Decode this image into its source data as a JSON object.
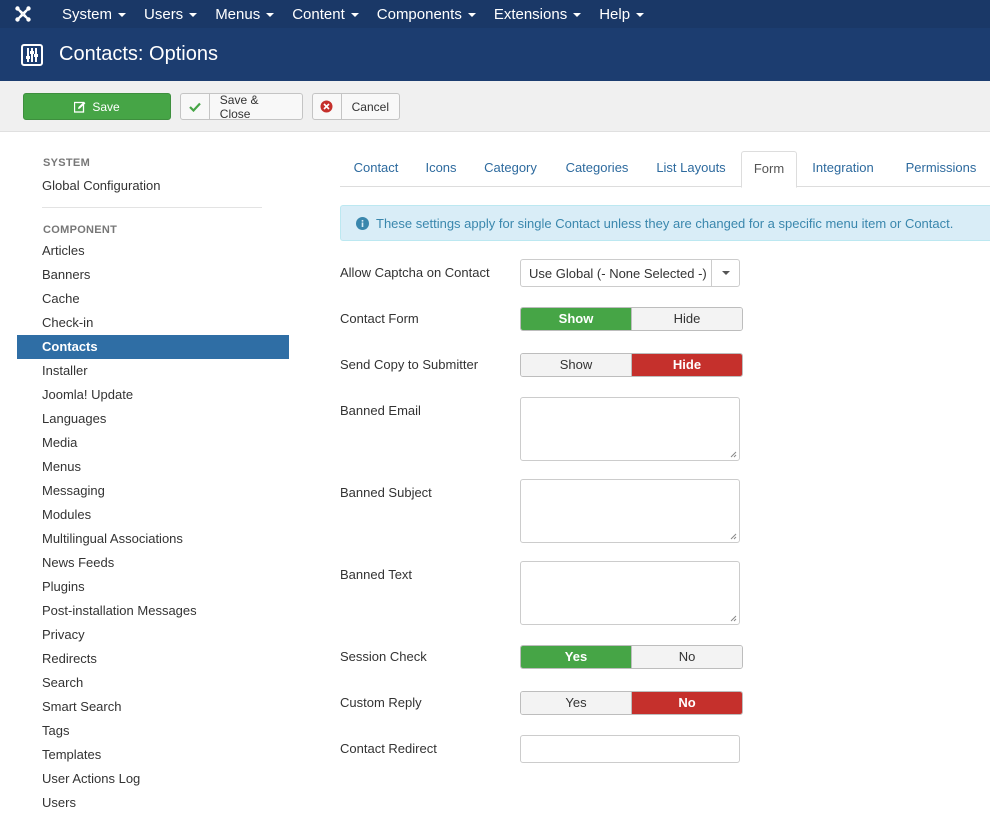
{
  "topnav": {
    "menu": [
      "System",
      "Users",
      "Menus",
      "Content",
      "Components",
      "Extensions",
      "Help"
    ]
  },
  "header": {
    "title": "Contacts: Options"
  },
  "toolbar": {
    "save_label": "Save",
    "save_close_label": "Save & Close",
    "cancel_label": "Cancel"
  },
  "sidebar": {
    "system_heading": "SYSTEM",
    "system_items": [
      "Global Configuration"
    ],
    "component_heading": "COMPONENT",
    "component_items": [
      "Articles",
      "Banners",
      "Cache",
      "Check-in",
      "Contacts",
      "Installer",
      "Joomla! Update",
      "Languages",
      "Media",
      "Menus",
      "Messaging",
      "Modules",
      "Multilingual Associations",
      "News Feeds",
      "Plugins",
      "Post-installation Messages",
      "Privacy",
      "Redirects",
      "Search",
      "Smart Search",
      "Tags",
      "Templates",
      "User Actions Log",
      "Users"
    ],
    "active_item": "Contacts"
  },
  "tabs": [
    "Contact",
    "Icons",
    "Category",
    "Categories",
    "List Layouts",
    "Form",
    "Integration",
    "Permissions"
  ],
  "active_tab": "Form",
  "alert": {
    "text": "These settings apply for single Contact unless they are changed for a specific menu item or Contact."
  },
  "form": {
    "captcha": {
      "label": "Allow Captcha on Contact",
      "value": "Use Global (- None Selected -)"
    },
    "contact_form": {
      "label": "Contact Form",
      "options": [
        "Show",
        "Hide"
      ],
      "selected": "Show"
    },
    "send_copy": {
      "label": "Send Copy to Submitter",
      "options": [
        "Show",
        "Hide"
      ],
      "selected": "Hide"
    },
    "banned_email": {
      "label": "Banned Email",
      "value": ""
    },
    "banned_subject": {
      "label": "Banned Subject",
      "value": ""
    },
    "banned_text": {
      "label": "Banned Text",
      "value": ""
    },
    "session_check": {
      "label": "Session Check",
      "options": [
        "Yes",
        "No"
      ],
      "selected": "Yes"
    },
    "custom_reply": {
      "label": "Custom Reply",
      "options": [
        "Yes",
        "No"
      ],
      "selected": "No"
    },
    "contact_redirect": {
      "label": "Contact Redirect",
      "value": ""
    }
  },
  "colors": {
    "nav": "#1a3867",
    "header": "#1c3d70",
    "green": "#46a546",
    "red": "#c5302c",
    "active_sidebar": "#2f6ea5",
    "link": "#2d6a9e",
    "alert_bg": "#d9edf7"
  }
}
